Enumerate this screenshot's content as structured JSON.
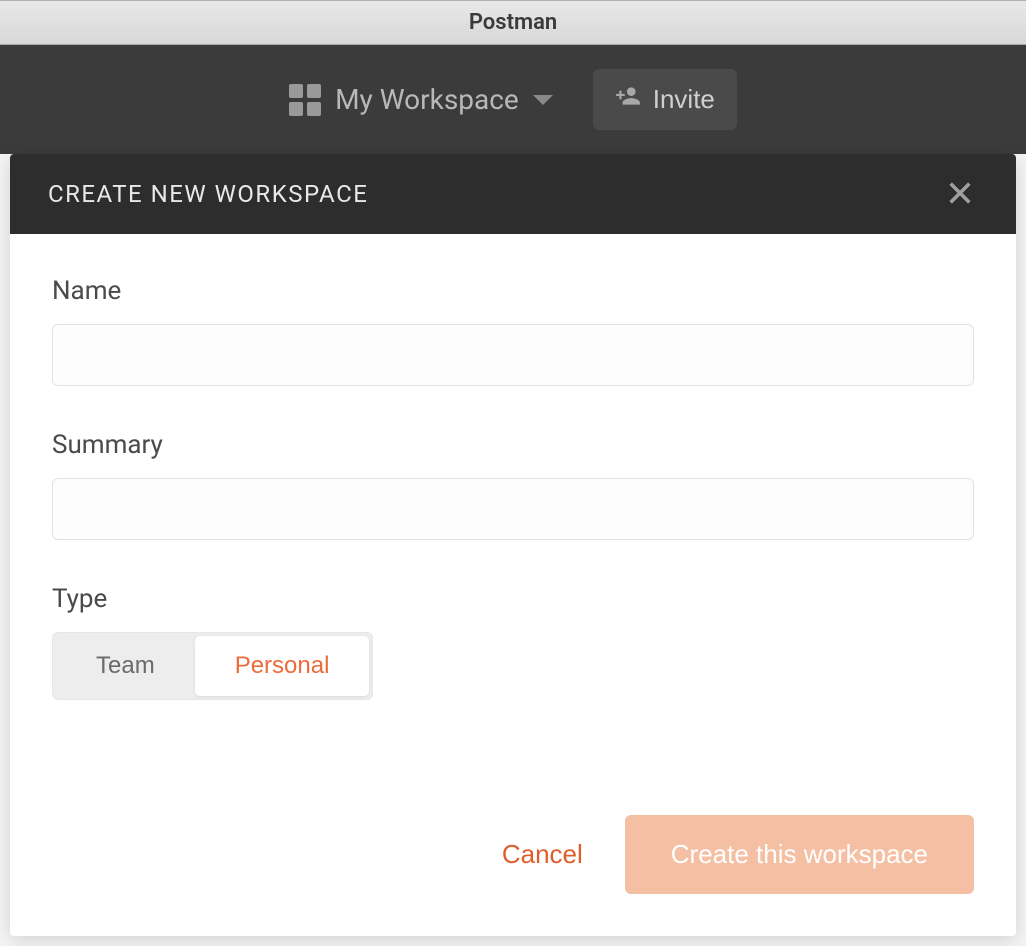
{
  "window": {
    "title": "Postman"
  },
  "toolbar": {
    "workspace_label": "My Workspace",
    "invite_label": "Invite"
  },
  "modal": {
    "title": "CREATE NEW WORKSPACE",
    "fields": {
      "name_label": "Name",
      "name_value": "",
      "summary_label": "Summary",
      "summary_value": "",
      "type_label": "Type",
      "type_options": {
        "team": "Team",
        "personal": "Personal"
      },
      "type_selected": "personal"
    },
    "actions": {
      "cancel": "Cancel",
      "create": "Create this workspace"
    }
  },
  "colors": {
    "accent": "#ed6b3b",
    "accent_light": "#f5bfa3",
    "header_dark": "#2d2d2d",
    "toolbar_dark": "#3b3b3b"
  }
}
